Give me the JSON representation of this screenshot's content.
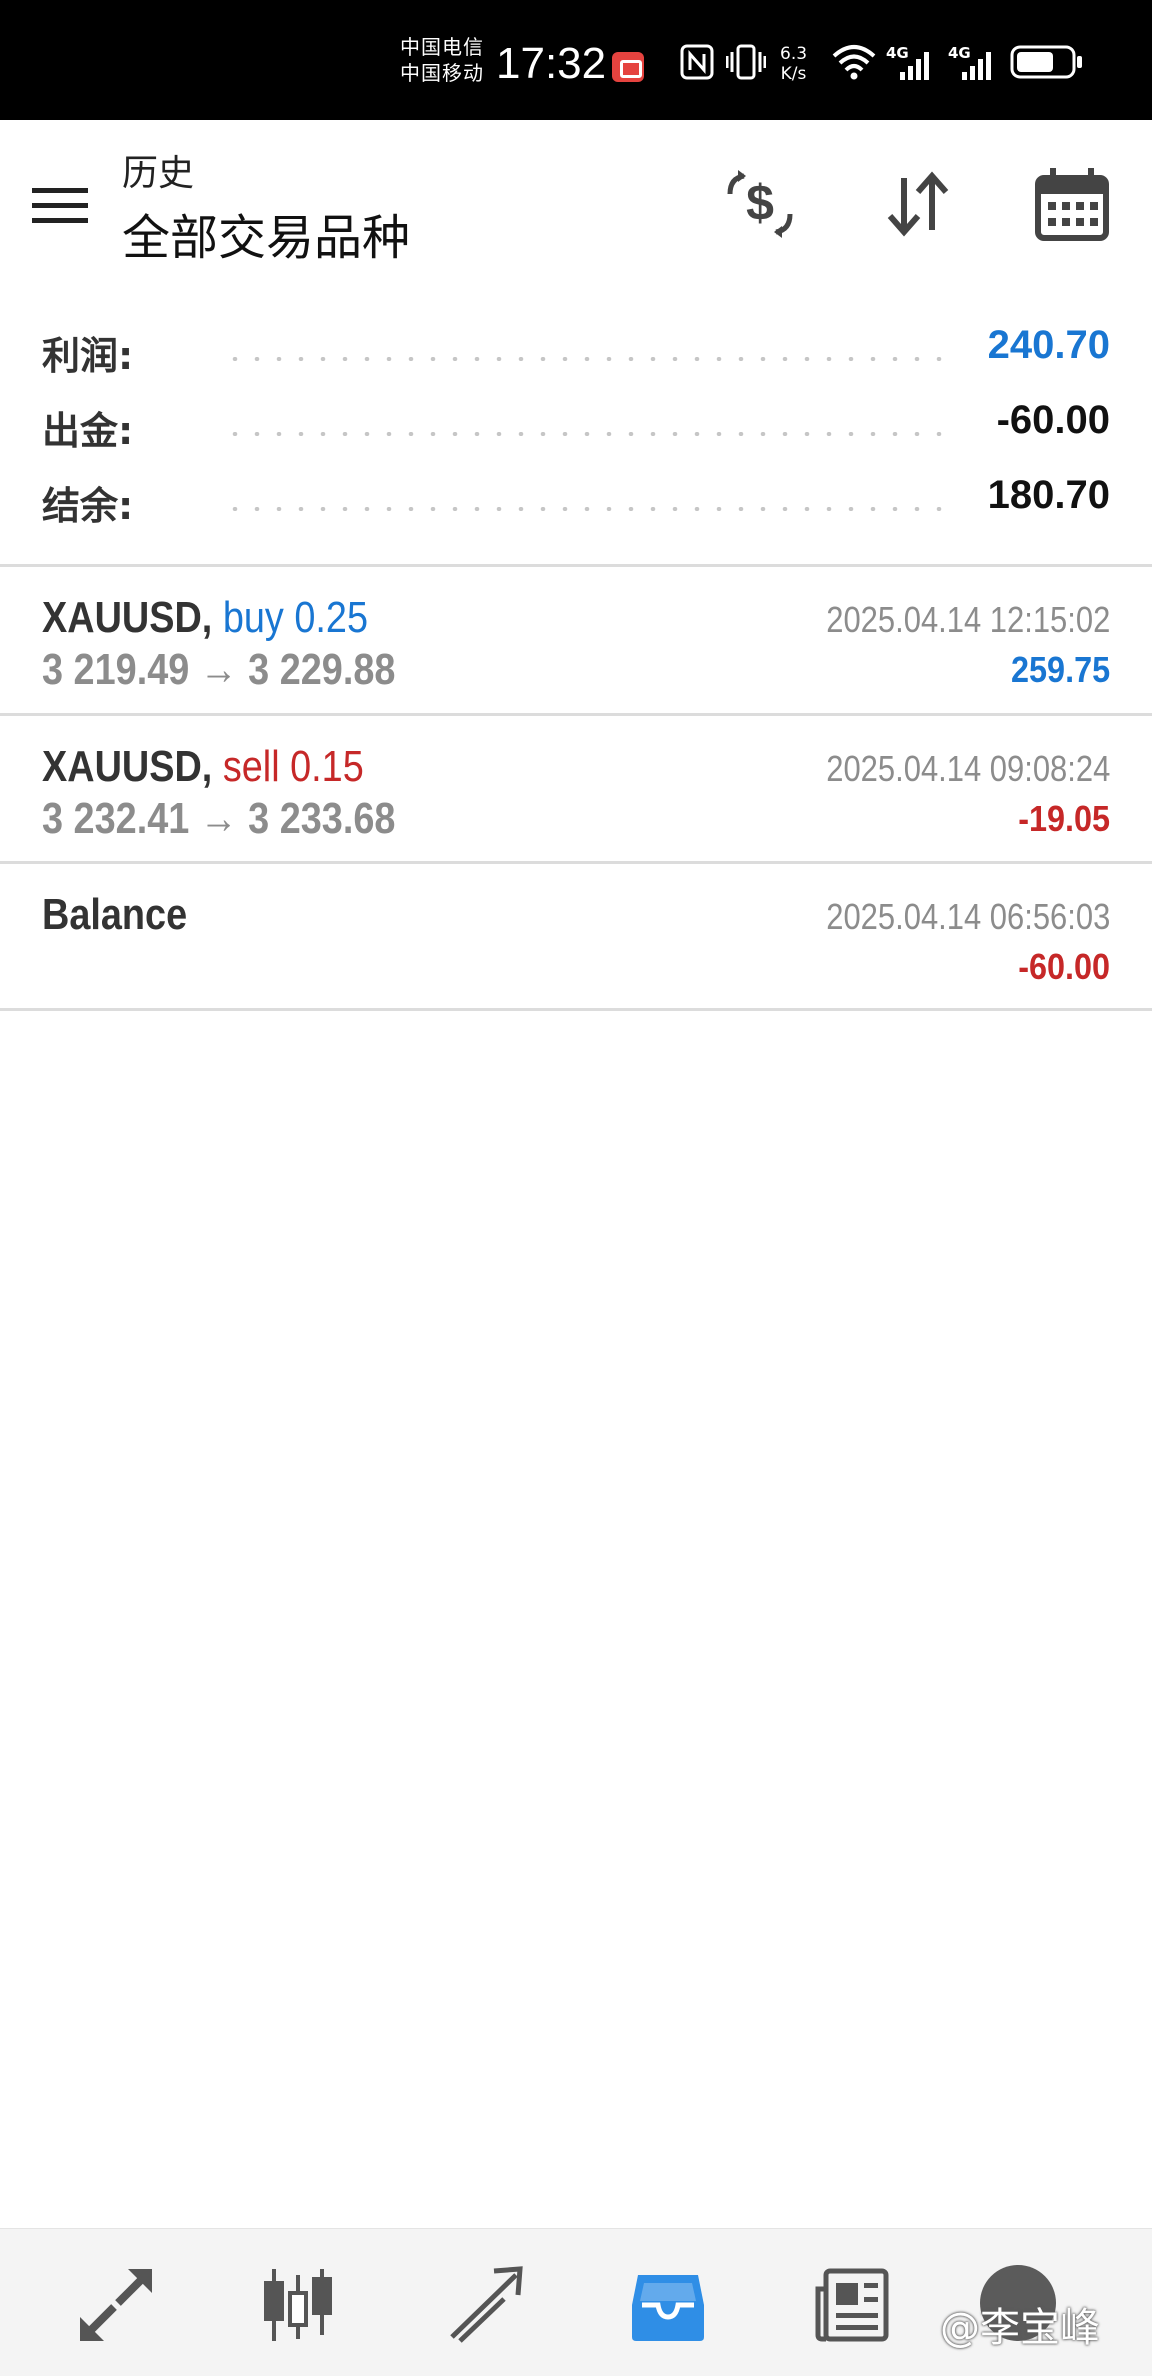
{
  "status_bar": {
    "carrier_1": "中国电信",
    "carrier_2": "中国移动",
    "time": "17:32",
    "net_speed_value": "6.3",
    "net_speed_unit": "K/s",
    "signal_1_label": "4G",
    "signal_2_label": "4G",
    "icons": [
      "notification-app-icon",
      "nfc-icon",
      "vibrate-icon",
      "wifi-icon",
      "signal-icon",
      "signal-icon",
      "battery-icon"
    ]
  },
  "header": {
    "subtitle": "历史",
    "title": "全部交易品种",
    "icons": [
      "menu-icon",
      "currency-exchange-icon",
      "sort-icon",
      "calendar-icon"
    ]
  },
  "summary": {
    "profit_label": "利润:",
    "profit_value": "240.70",
    "withdrawal_label": "出金:",
    "withdrawal_value": "-60.00",
    "balance_label": "结余:",
    "balance_value": "180.70"
  },
  "deals": [
    {
      "symbol": "XAUUSD,",
      "type": "buy 0.25",
      "prices": "3 219.49 → 3 229.88",
      "time": "2025.04.14 12:15:02",
      "profit": "259.75"
    },
    {
      "symbol": "XAUUSD,",
      "type": "sell 0.15",
      "prices": "3 232.41 → 3 233.68",
      "time": "2025.04.14 09:08:24",
      "profit": "-19.05"
    },
    {
      "symbol": "Balance",
      "type": "",
      "prices": "",
      "time": "2025.04.14 06:56:03",
      "profit": "-60.00"
    }
  ],
  "bottom_nav": {
    "items": [
      "quotes-icon",
      "chart-icon",
      "trade-icon",
      "history-icon",
      "news-icon",
      "profile-avatar"
    ],
    "active": "history-icon",
    "watermark": "@李宝峰"
  },
  "colors": {
    "buy_blue": "#1976d2",
    "sell_red": "#c62828",
    "active_nav": "#2f8ee6",
    "inactive_nav": "#555555",
    "muted_text": "#8c8c8c"
  }
}
